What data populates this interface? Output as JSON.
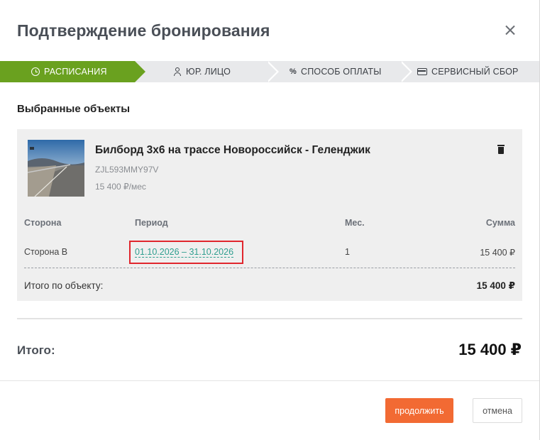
{
  "modal": {
    "title": "Подтверждение бронирования"
  },
  "steps": [
    {
      "label": "РАСПИСАНИЯ",
      "icon": "clock-icon",
      "active": true
    },
    {
      "label": "ЮР. ЛИЦО",
      "icon": "user-icon",
      "active": false
    },
    {
      "label": "СПОСОБ ОПЛАТЫ",
      "icon": "percent-icon",
      "active": false
    },
    {
      "label": "СЕРВИСНЫЙ СБОР",
      "icon": "card-icon",
      "active": false
    }
  ],
  "selected": {
    "section_title": "Выбранные объекты",
    "object": {
      "name": "Билборд 3х6 на трассе Новороссийск - Геленджик",
      "code": "ZJL593MMY97V",
      "price": "15 400 ₽/мес"
    },
    "table": {
      "headers": {
        "side": "Сторона",
        "period": "Период",
        "months": "Мес.",
        "sum": "Сумма"
      },
      "rows": [
        {
          "side": "Сторона B",
          "period": "01.10.2026 – 31.10.2026",
          "months": "1",
          "sum": "15 400 ₽"
        }
      ]
    },
    "subtotal_label": "Итого по объекту:",
    "subtotal_value": "15 400 ₽"
  },
  "total": {
    "label": "Итого:",
    "value": "15 400 ₽"
  },
  "buttons": {
    "continue": "продолжить",
    "cancel": "отмена"
  },
  "colors": {
    "active_step": "#6aa11f",
    "primary_button": "#f26a33",
    "period_link": "#2e9e8f",
    "highlight": "#e0262d"
  }
}
